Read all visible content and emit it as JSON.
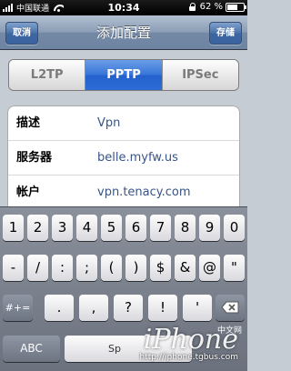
{
  "status_bar": {
    "carrier": "中国联通",
    "time": "10:34",
    "battery_percent": "62 %",
    "battery_level": 0.62
  },
  "nav_bar": {
    "title": "添加配置",
    "cancel_label": "取消",
    "save_label": "存储"
  },
  "segmented": {
    "options": [
      "L2TP",
      "PPTP",
      "IPSec"
    ],
    "selected": "PPTP"
  },
  "fields": [
    {
      "label": "描述",
      "value": "Vpn"
    },
    {
      "label": "服务器",
      "value": "belle.myfw.us"
    },
    {
      "label": "帐户",
      "value": "vpn.tenacy.com"
    }
  ],
  "keyboard": {
    "row1": [
      "1",
      "2",
      "3",
      "4",
      "5",
      "6",
      "7",
      "8",
      "9",
      "0"
    ],
    "row2": [
      "-",
      "/",
      ":",
      ";",
      "(",
      ")",
      "$",
      "&",
      "@"
    ],
    "row3_symbols_label": "#+=",
    "row3": [
      ".",
      ",",
      "?",
      "!",
      "'"
    ],
    "abc_label": "ABC",
    "space_label": "Sp"
  },
  "watermark": {
    "brand": "iPhone",
    "cn": "中文网",
    "url": "http://iphone.tgbus.com"
  },
  "colors": {
    "nav_bar": "#7489a5",
    "segment_active": "#2d6cd6",
    "value_text": "#385487"
  }
}
